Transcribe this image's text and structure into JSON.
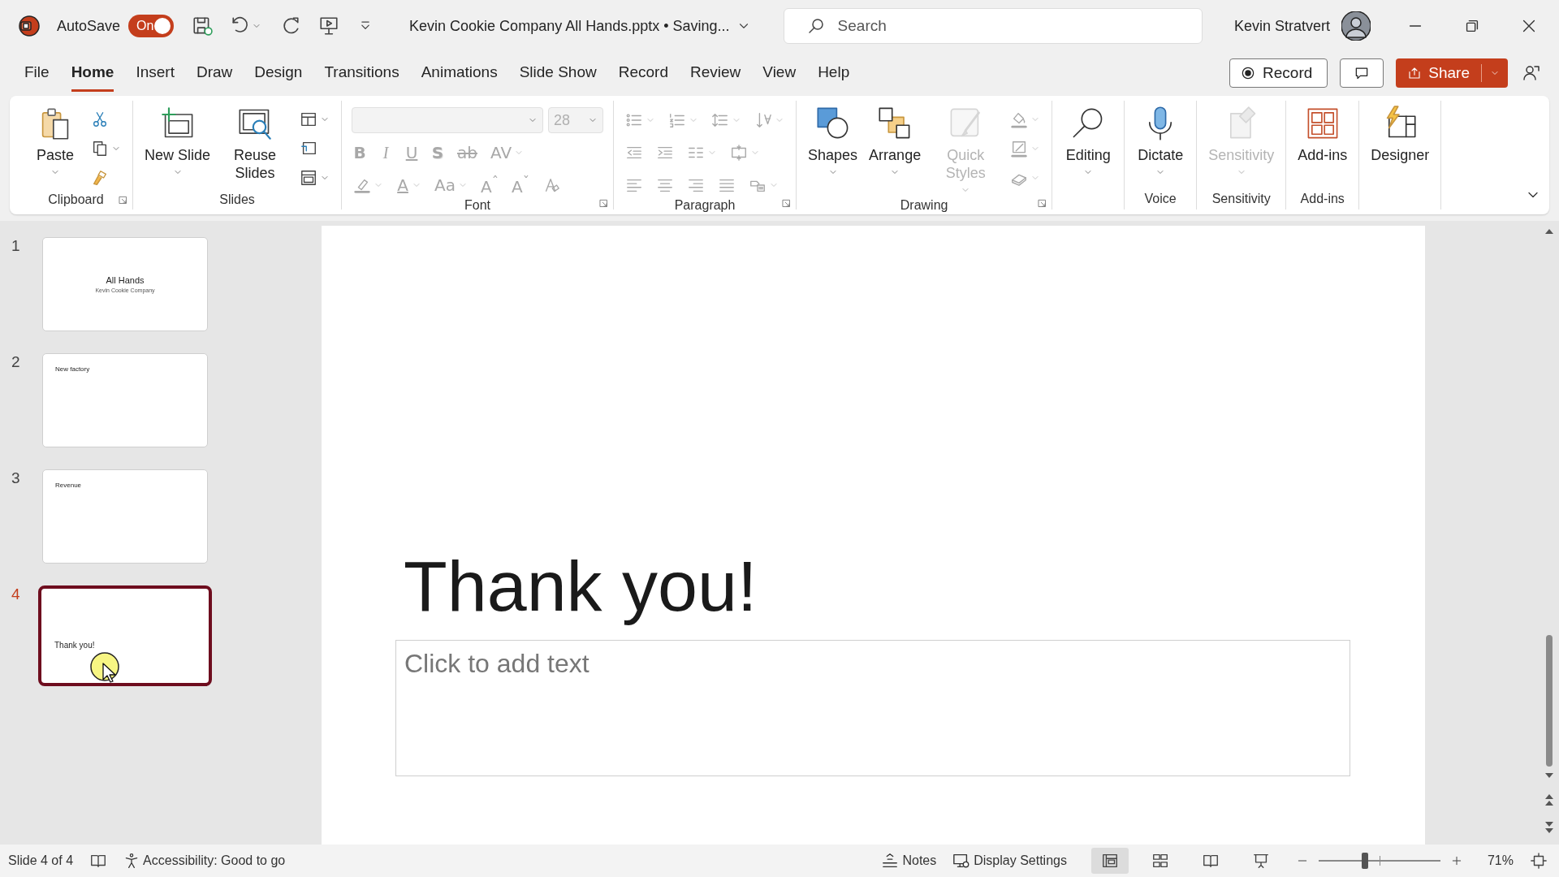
{
  "title_bar": {
    "autosave": {
      "label": "AutoSave",
      "toggle_text": "On",
      "on": true
    },
    "document_title": "Kevin Cookie Company All Hands.pptx • Saving...",
    "search": {
      "placeholder": "Search"
    },
    "user": {
      "name": "Kevin Stratvert"
    }
  },
  "menu_tabs": [
    {
      "label": "File",
      "selected": false
    },
    {
      "label": "Home",
      "selected": true
    },
    {
      "label": "Insert",
      "selected": false
    },
    {
      "label": "Draw",
      "selected": false
    },
    {
      "label": "Design",
      "selected": false
    },
    {
      "label": "Transitions",
      "selected": false
    },
    {
      "label": "Animations",
      "selected": false
    },
    {
      "label": "Slide Show",
      "selected": false
    },
    {
      "label": "Record",
      "selected": false
    },
    {
      "label": "Review",
      "selected": false
    },
    {
      "label": "View",
      "selected": false
    },
    {
      "label": "Help",
      "selected": false
    }
  ],
  "header_buttons": {
    "record": "Record",
    "share": "Share"
  },
  "ribbon": {
    "groups": [
      {
        "label": "Clipboard",
        "launcher": true,
        "parts": [
          {
            "kind": "large",
            "label": "Paste",
            "caret": true,
            "disabled": false
          },
          {
            "kind": "stack",
            "items": [
              {
                "disabled": false
              },
              {
                "caret": true,
                "disabled": false
              },
              {
                "disabled": false
              }
            ]
          }
        ]
      },
      {
        "label": "Slides",
        "parts": [
          {
            "kind": "large",
            "label": "New Slide",
            "caret": true,
            "disabled": false
          },
          {
            "kind": "large",
            "label": "Reuse Slides",
            "disabled": false
          },
          {
            "kind": "stack",
            "items": [
              {
                "caret": true,
                "disabled": false
              },
              {
                "disabled": false
              },
              {
                "caret": true,
                "disabled": false
              }
            ]
          }
        ]
      },
      {
        "label": "Font",
        "launcher": true,
        "parts": [
          {
            "kind": "lines",
            "lines": [
              {
                "items": [
                  {
                    "kind": "field",
                    "disabled": true
                  },
                  {
                    "kind": "field",
                    "text": "28",
                    "disabled": true
                  }
                ]
              },
              {
                "items": [
                  {
                    "kind": "glyph",
                    "text": "B",
                    "disabled": true
                  },
                  {
                    "kind": "glyph",
                    "text": "I",
                    "disabled": true
                  },
                  {
                    "kind": "glyph",
                    "text": "U",
                    "disabled": true
                  },
                  {
                    "kind": "glyph",
                    "text": "S",
                    "disabled": true
                  },
                  {
                    "kind": "glyph",
                    "text": "ab",
                    "disabled": true
                  },
                  {
                    "kind": "glyph",
                    "text": "AV",
                    "caret": true,
                    "disabled": true
                  }
                ]
              },
              {
                "items": [
                  {
                    "kind": "icon",
                    "caret": true,
                    "disabled": true
                  },
                  {
                    "kind": "glyph",
                    "text": "A",
                    "caret": true,
                    "disabled": true
                  },
                  {
                    "kind": "glyph",
                    "text": "Aa",
                    "caret": true,
                    "disabled": true
                  },
                  {
                    "kind": "glyph",
                    "text": "A$^{ˆ}$",
                    "disabled": true
                  },
                  {
                    "kind": "glyph",
                    "text": "A$^{ˇ}$",
                    "disabled": true
                  },
                  {
                    "kind": "icon",
                    "disabled": true
                  }
                ]
              }
            ]
          }
        ]
      },
      {
        "label": "Paragraph",
        "launcher": true,
        "parts": [
          {
            "kind": "lines",
            "lines": [
              {
                "items": [
                  {
                    "kind": "icon",
                    "caret": true,
                    "disabled": true
                  },
                  {
                    "kind": "icon",
                    "caret": true,
                    "disabled": true
                  },
                  {
                    "kind": "icon",
                    "caret": true,
                    "disabled": true
                  },
                  {
                    "kind": "icon",
                    "caret": true,
                    "disabled": true
                  }
                ]
              },
              {
                "items": [
                  {
                    "kind": "icon",
                    "disabled": true
                  },
                  {
                    "kind": "icon",
                    "disabled": true
                  },
                  {
                    "kind": "icon",
                    "caret": true,
                    "disabled": true
                  },
                  {
                    "kind": "icon",
                    "caret": true,
                    "disabled": true
                  }
                ]
              },
              {
                "items": [
                  {
                    "kind": "icon",
                    "disabled": true
                  },
                  {
                    "kind": "icon",
                    "disabled": true
                  },
                  {
                    "kind": "icon",
                    "disabled": true
                  },
                  {
                    "kind": "icon",
                    "disabled": true
                  },
                  {
                    "kind": "icon",
                    "caret": true,
                    "disabled": true
                  }
                ]
              }
            ]
          }
        ]
      },
      {
        "label": "Drawing",
        "launcher": true,
        "parts": [
          {
            "kind": "large",
            "label": "Shapes",
            "caret": true,
            "disabled": false
          },
          {
            "kind": "large",
            "label": "Arrange",
            "caret": true,
            "disabled": false
          },
          {
            "kind": "large",
            "label": "Quick Styles",
            "caret": true,
            "disabled": true
          },
          {
            "kind": "stack",
            "items": [
              {
                "caret": true,
                "disabled": true
              },
              {
                "caret": true,
                "disabled": true
              },
              {
                "caret": true,
                "disabled": true
              }
            ]
          }
        ]
      },
      {
        "parts": [
          {
            "kind": "large",
            "label": "Editing",
            "caret": true,
            "disabled": false
          }
        ]
      },
      {
        "label": "Voice",
        "parts": [
          {
            "kind": "large",
            "label": "Dictate",
            "caret": true,
            "disabled": false
          }
        ]
      },
      {
        "label": "Sensitivity",
        "parts": [
          {
            "kind": "large",
            "label": "Sensitivity",
            "caret": true,
            "disabled": true
          }
        ]
      },
      {
        "label": "Add-ins",
        "parts": [
          {
            "kind": "large",
            "label": "Add-ins",
            "disabled": false
          }
        ]
      },
      {
        "parts": [
          {
            "kind": "large",
            "label": "Designer",
            "disabled": false
          }
        ]
      }
    ]
  },
  "slides": [
    {
      "number": "1",
      "kind": "title",
      "title": "All Hands",
      "subtitle": "Kevin Cookie Company",
      "selected": false
    },
    {
      "number": "2",
      "kind": "heading",
      "title": "New factory",
      "selected": false
    },
    {
      "number": "3",
      "kind": "heading",
      "title": "Revenue",
      "selected": false
    },
    {
      "number": "4",
      "kind": "closing",
      "title": "Thank you!",
      "selected": true
    }
  ],
  "slide": {
    "title": "Thank you!",
    "placeholder": "Click to add text"
  },
  "status_bar": {
    "slide_info": "Slide 4 of 4",
    "accessibility": "Accessibility: Good to go",
    "notes": "Notes",
    "display_settings": "Display Settings",
    "views": [
      {
        "selected": true
      },
      {
        "selected": false
      },
      {
        "selected": false
      },
      {
        "selected": false
      }
    ],
    "zoom": {
      "level": 0.38,
      "reading": "71%"
    }
  }
}
